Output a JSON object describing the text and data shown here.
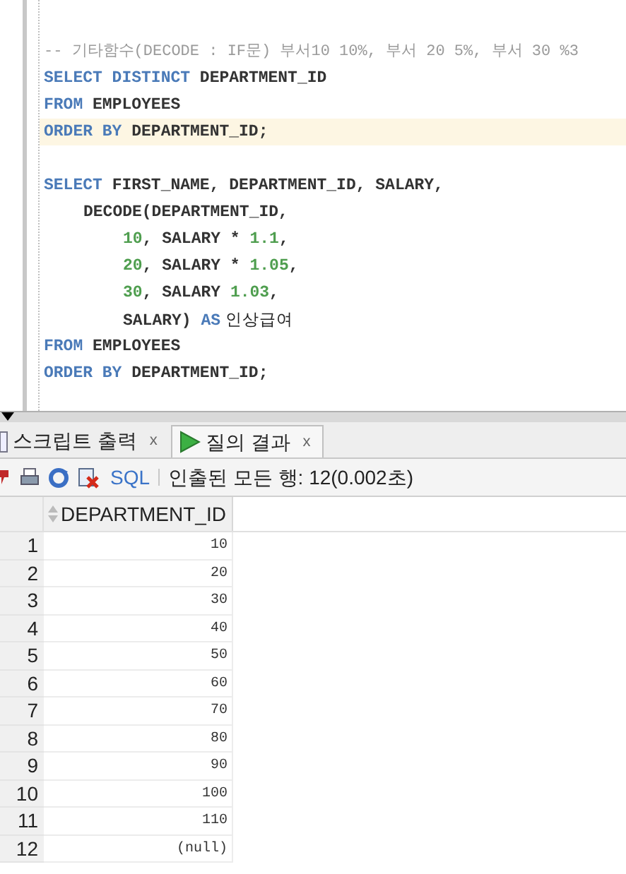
{
  "editor": {
    "statements": [
      {
        "lines": [
          {
            "highlighted": false,
            "tokens": [
              {
                "kind": "comment",
                "text": "-- 기타함수(DECODE : IF문) 부서10 10%, 부서 20 5%, 부서 30 %3"
              }
            ]
          },
          {
            "highlighted": false,
            "tokens": [
              {
                "kind": "keyword",
                "text": "SELECT DISTINCT"
              },
              {
                "kind": "plain",
                "text": " DEPARTMENT_ID"
              }
            ]
          },
          {
            "highlighted": false,
            "tokens": [
              {
                "kind": "keyword",
                "text": "FROM"
              },
              {
                "kind": "plain",
                "text": " EMPLOYEES"
              }
            ]
          },
          {
            "highlighted": true,
            "tokens": [
              {
                "kind": "keyword",
                "text": "ORDER BY"
              },
              {
                "kind": "plain",
                "text": " DEPARTMENT_ID;"
              }
            ]
          }
        ]
      },
      {
        "lines": [
          {
            "highlighted": false,
            "tokens": [
              {
                "kind": "keyword",
                "text": "SELECT"
              },
              {
                "kind": "plain",
                "text": " FIRST_NAME, DEPARTMENT_ID, SALARY,"
              }
            ],
            "children": [
              {
                "highlighted": false,
                "tokens": [
                  {
                    "kind": "plain",
                    "text": "DECODE(DEPARTMENT_ID,"
                  }
                ],
                "children": [
                  {
                    "highlighted": false,
                    "tokens": [
                      {
                        "kind": "number",
                        "text": "10"
                      },
                      {
                        "kind": "plain",
                        "text": ", SALARY * "
                      },
                      {
                        "kind": "number",
                        "text": "1.1"
                      },
                      {
                        "kind": "plain",
                        "text": ","
                      }
                    ]
                  },
                  {
                    "highlighted": false,
                    "tokens": [
                      {
                        "kind": "number",
                        "text": "20"
                      },
                      {
                        "kind": "plain",
                        "text": ", SALARY * "
                      },
                      {
                        "kind": "number",
                        "text": "1.05"
                      },
                      {
                        "kind": "plain",
                        "text": ","
                      }
                    ]
                  },
                  {
                    "highlighted": false,
                    "tokens": [
                      {
                        "kind": "number",
                        "text": "30"
                      },
                      {
                        "kind": "plain",
                        "text": ", SALARY "
                      },
                      {
                        "kind": "number",
                        "text": "1.03"
                      },
                      {
                        "kind": "plain",
                        "text": ","
                      }
                    ]
                  },
                  {
                    "highlighted": false,
                    "tokens": [
                      {
                        "kind": "plain",
                        "text": "SALARY) "
                      },
                      {
                        "kind": "keyword",
                        "text": "AS"
                      },
                      {
                        "kind": "hangul",
                        "text": " 인상급여"
                      }
                    ]
                  }
                ]
              }
            ]
          },
          {
            "highlighted": false,
            "tokens": [
              {
                "kind": "keyword",
                "text": "FROM"
              },
              {
                "kind": "plain",
                "text": " EMPLOYEES"
              }
            ]
          },
          {
            "highlighted": false,
            "tokens": [
              {
                "kind": "keyword",
                "text": "ORDER BY"
              },
              {
                "kind": "plain",
                "text": " DEPARTMENT_ID;"
              }
            ]
          }
        ]
      }
    ]
  },
  "tabs": [
    {
      "label": "스크립트 출력",
      "close": "x",
      "selected": false
    },
    {
      "label": "질의 결과",
      "close": "x",
      "selected": true
    }
  ],
  "toolbar": {
    "sql_link": "SQL",
    "status": "인출된 모든 행: 12(0.002초)"
  },
  "grid": {
    "columns": [
      "DEPARTMENT_ID"
    ],
    "rows": [
      {
        "number": "1",
        "cells": [
          "10"
        ]
      },
      {
        "number": "2",
        "cells": [
          "20"
        ]
      },
      {
        "number": "3",
        "cells": [
          "30"
        ]
      },
      {
        "number": "4",
        "cells": [
          "40"
        ]
      },
      {
        "number": "5",
        "cells": [
          "50"
        ]
      },
      {
        "number": "6",
        "cells": [
          "60"
        ]
      },
      {
        "number": "7",
        "cells": [
          "70"
        ]
      },
      {
        "number": "8",
        "cells": [
          "80"
        ]
      },
      {
        "number": "9",
        "cells": [
          "90"
        ]
      },
      {
        "number": "10",
        "cells": [
          "100"
        ]
      },
      {
        "number": "11",
        "cells": [
          "110"
        ]
      },
      {
        "number": "12",
        "cells": [
          "(null)"
        ]
      }
    ]
  }
}
